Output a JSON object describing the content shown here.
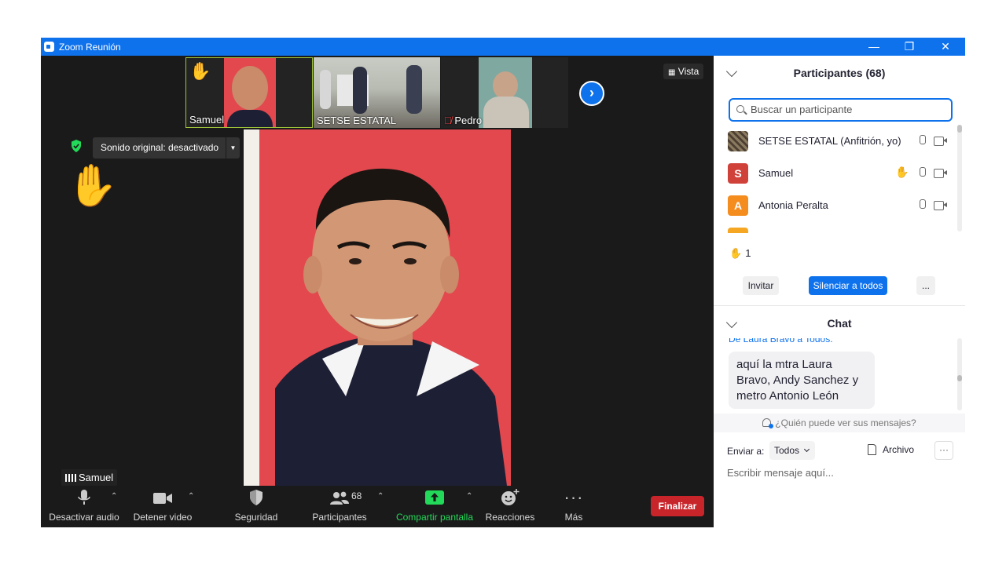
{
  "window": {
    "title": "Zoom Reunión",
    "minimize": "—",
    "restore": "❐",
    "close": "✕"
  },
  "video": {
    "thumbnails": [
      {
        "name": "Samuel"
      },
      {
        "name": "SETSE ESTATAL"
      },
      {
        "name": "Pedro"
      }
    ],
    "next_icon": "›",
    "view_label": "Vista",
    "original_sound": "Sonido original: desactivado",
    "active_speaker": "Samuel"
  },
  "toolbar": {
    "mute": "Desactivar audio",
    "stop_video": "Detener video",
    "security": "Seguridad",
    "participants": "Participantes",
    "participants_count": "68",
    "share": "Compartir pantalla",
    "reactions": "Reacciones",
    "more": "Más",
    "end": "Finalizar",
    "colors": {
      "share": "#23d959",
      "end": "#c8252b"
    }
  },
  "participants_panel": {
    "title": "Participantes (68)",
    "search_placeholder": "Buscar un participante",
    "list": [
      {
        "name": "SETSE ESTATAL (Anfitrión, yo)",
        "avatar": "",
        "color": "#6b5a44"
      },
      {
        "name": "Samuel",
        "avatar": "S",
        "color": "#d0413a",
        "hand": true
      },
      {
        "name": "Antonia Peralta",
        "avatar": "A",
        "color": "#f48c1e"
      }
    ],
    "raised_hands_count": "1",
    "invite": "Invitar",
    "mute_all": "Silenciar a todos",
    "more": "..."
  },
  "chat": {
    "title": "Chat",
    "from_line": "De Laura Bravo a Todos:",
    "message": "aquí la mtra Laura Bravo, Andy Sanchez y metro Antonio León",
    "who_sees": "¿Quién puede ver sus mensajes?",
    "send_to_label": "Enviar a:",
    "send_to_value": "Todos",
    "file": "Archivo",
    "more": "···",
    "input_placeholder": "Escribir mensaje aquí..."
  }
}
